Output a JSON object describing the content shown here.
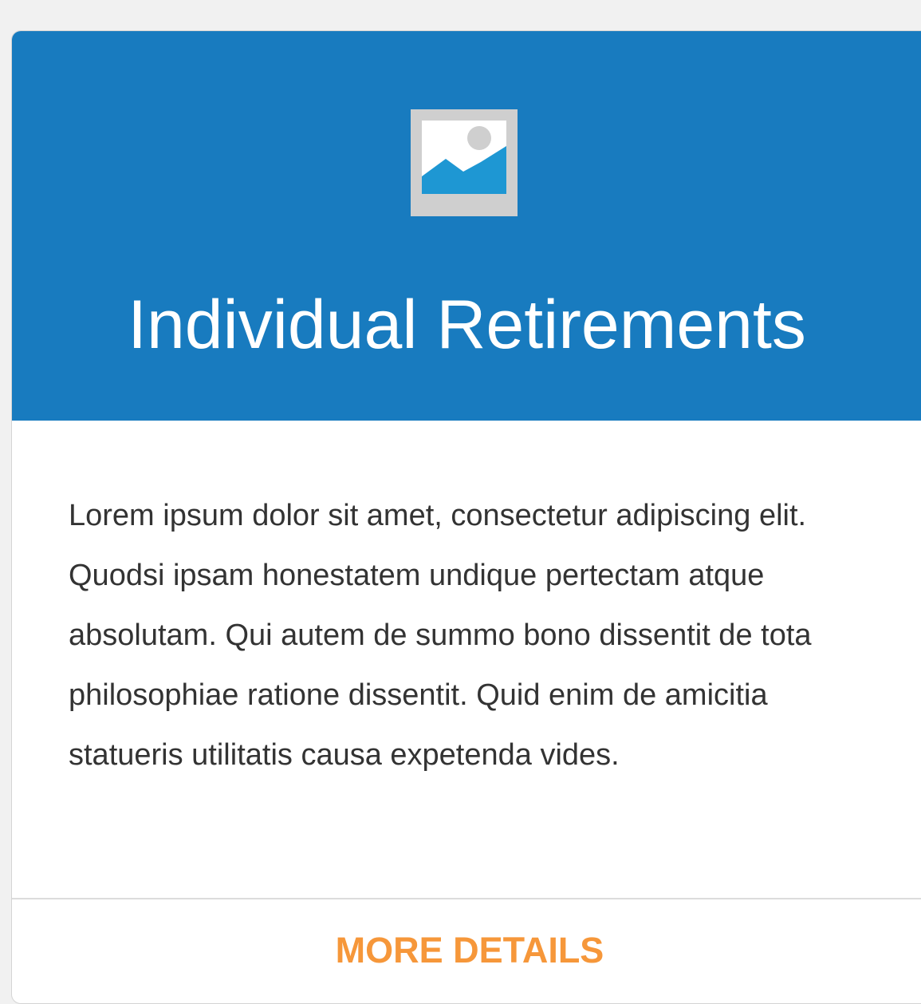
{
  "card": {
    "header": {
      "background_color": "#187bbf",
      "icon": "image-placeholder-icon",
      "title": "Individual Retirements"
    },
    "body": {
      "text": "Lorem ipsum dolor sit amet, consectetur adipiscing elit. Quodsi ipsam honestatem undique pertectam atque absolutam. Qui autem de summo bono dissentit de tota philosophiae ratione dissentit. Quid enim de amicitia statueris utilitatis causa expetenda vides."
    },
    "footer": {
      "link_label": "MORE DETAILS",
      "link_color": "#f6973a"
    }
  }
}
